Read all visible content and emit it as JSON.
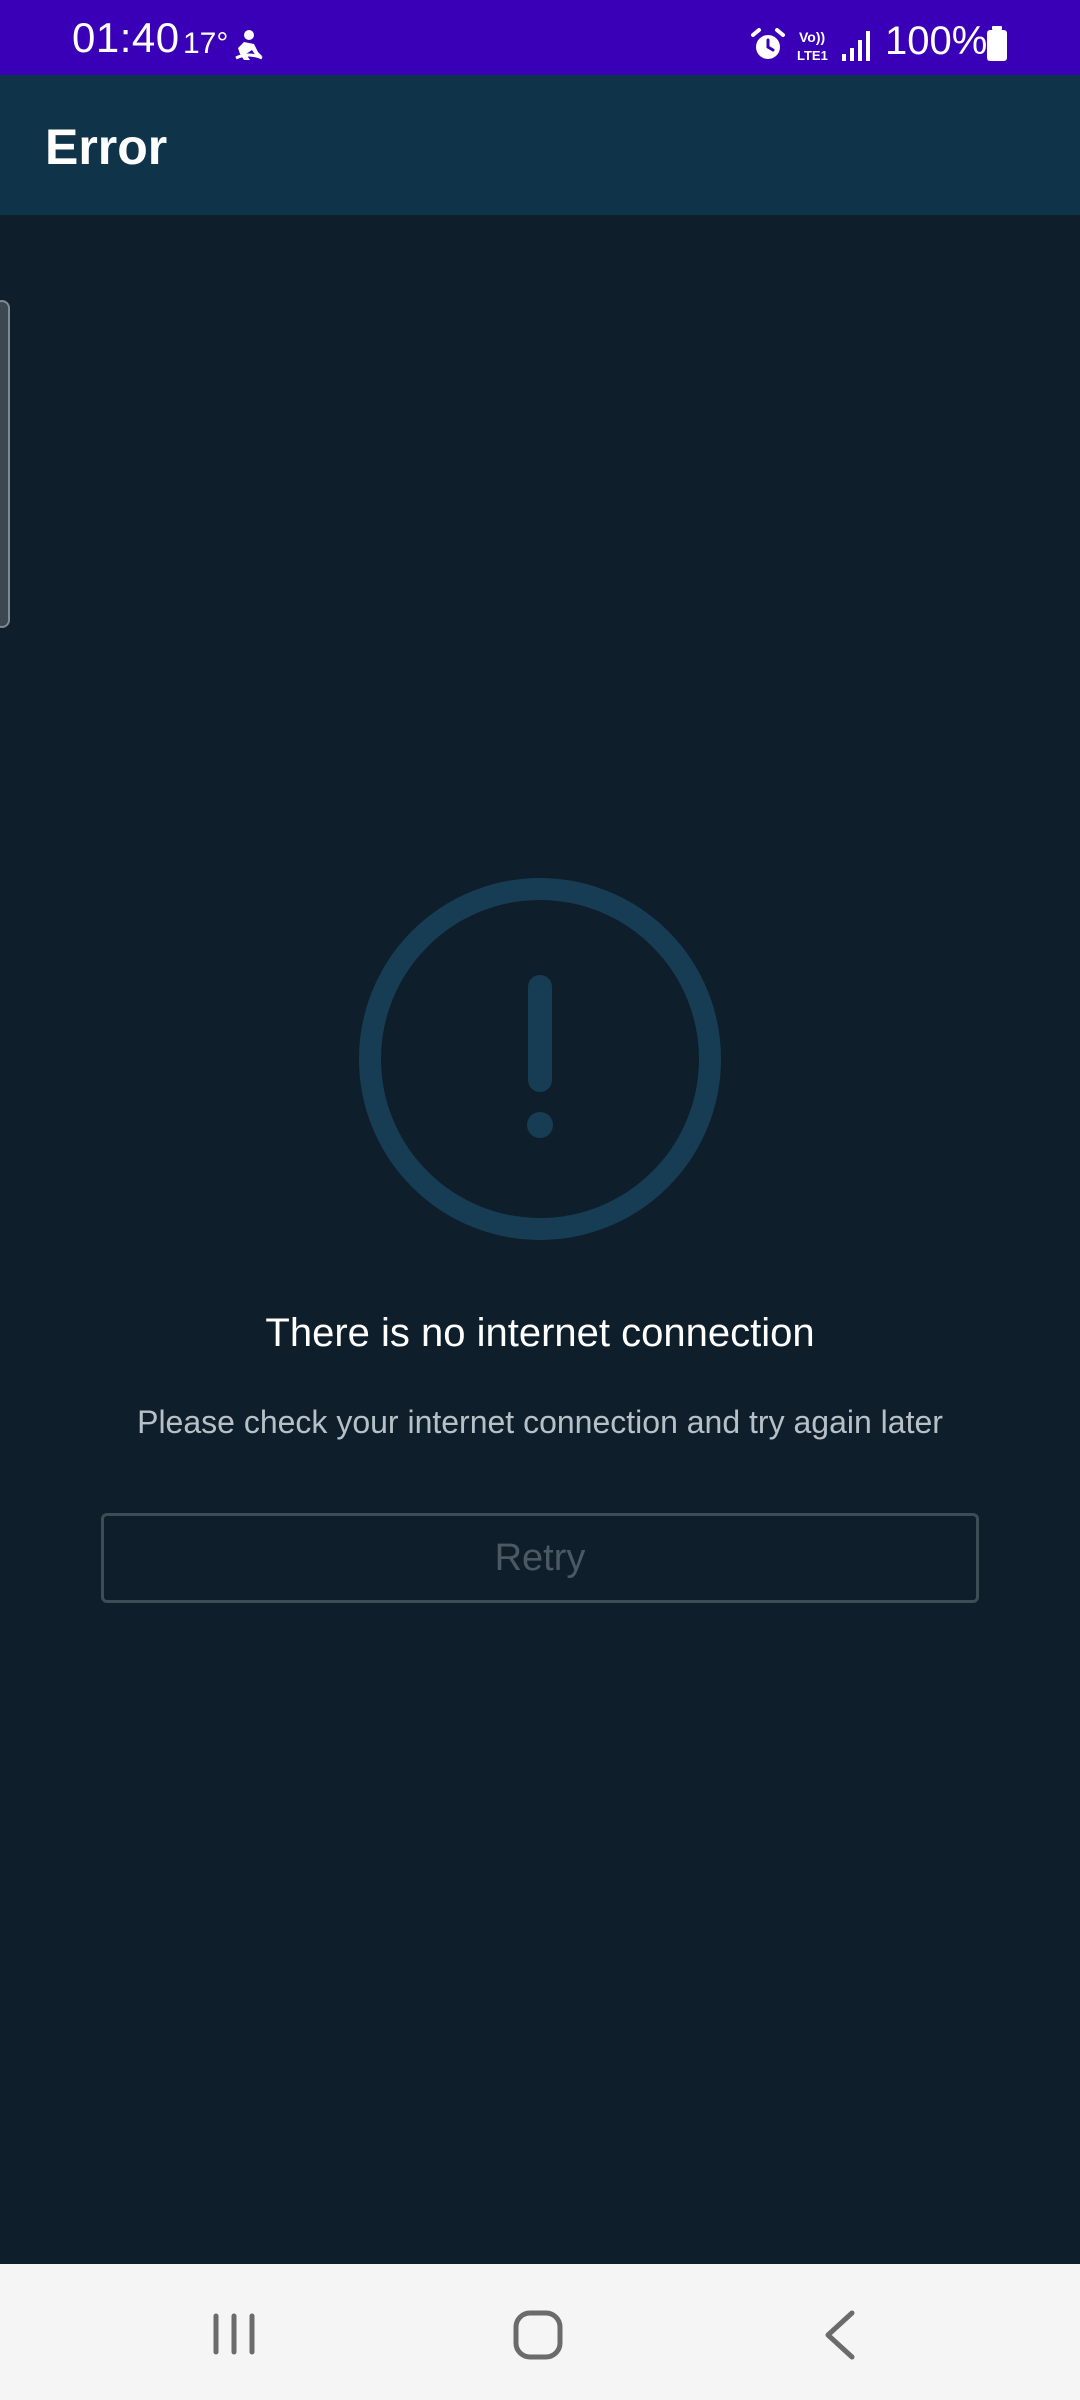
{
  "status_bar": {
    "time": "01:40",
    "temperature": "17°",
    "battery": "100%",
    "icons": [
      "weather-icon",
      "alarm-icon",
      "volte-icon",
      "signal-icon",
      "battery-icon"
    ],
    "background_color": "#3a00b8"
  },
  "app_bar": {
    "title": "Error",
    "background_color": "#0f344a"
  },
  "error": {
    "icon": "exclamation-circle-icon",
    "title": "There is no internet connection",
    "message": "Please check your internet connection and try again later",
    "retry_label": "Retry",
    "icon_color": "#173d55"
  },
  "nav_bar": {
    "icons": [
      "recents-icon",
      "home-icon",
      "back-icon"
    ]
  },
  "colors": {
    "background": "#0e1f2b",
    "title_text": "#ffffff",
    "message_text": "#b7c0c6",
    "disabled_button": "#4a5964"
  }
}
